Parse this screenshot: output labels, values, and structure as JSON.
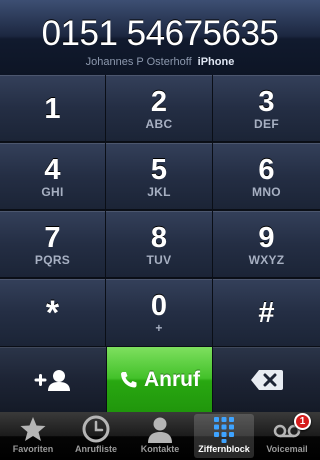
{
  "header": {
    "number": "0151 54675635",
    "contact_name": "Johannes P Osterhoff",
    "number_label": "iPhone"
  },
  "keypad": [
    {
      "digit": "1",
      "letters": ""
    },
    {
      "digit": "2",
      "letters": "ABC"
    },
    {
      "digit": "3",
      "letters": "DEF"
    },
    {
      "digit": "4",
      "letters": "GHI"
    },
    {
      "digit": "5",
      "letters": "JKL"
    },
    {
      "digit": "6",
      "letters": "MNO"
    },
    {
      "digit": "7",
      "letters": "PQRS"
    },
    {
      "digit": "8",
      "letters": "TUV"
    },
    {
      "digit": "9",
      "letters": "WXYZ"
    },
    {
      "digit": "*",
      "letters": ""
    },
    {
      "digit": "0",
      "letters": "+"
    },
    {
      "digit": "#",
      "letters": ""
    }
  ],
  "actions": {
    "call_label": "Anruf",
    "add_contact_icon": "add-contact-icon",
    "backspace_icon": "backspace-icon"
  },
  "tabs": [
    {
      "label": "Favoriten",
      "icon": "star-icon",
      "active": false
    },
    {
      "label": "Anrufliste",
      "icon": "clock-icon",
      "active": false
    },
    {
      "label": "Kontakte",
      "icon": "person-icon",
      "active": false
    },
    {
      "label": "Ziffernblock",
      "icon": "keypad-icon",
      "active": true
    },
    {
      "label": "Voicemail",
      "icon": "voicemail-icon",
      "active": false,
      "badge": "1"
    }
  ],
  "colors": {
    "call_green": "#43c12a",
    "badge_red": "#d51c1c",
    "key_blue": "#242e44"
  }
}
